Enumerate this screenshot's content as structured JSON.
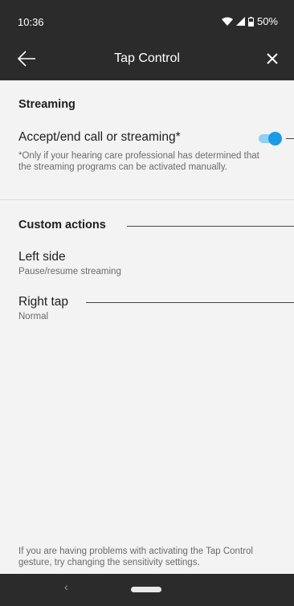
{
  "status_bar": {
    "time": "10:36",
    "battery": "50%",
    "icons": [
      "wifi-icon",
      "signal-icon",
      "battery-icon"
    ]
  },
  "app_bar": {
    "title": "Tap Control",
    "back_icon": "arrow-left-icon",
    "close_icon": "close-icon"
  },
  "streaming": {
    "heading": "Streaming",
    "toggle_label": "Accept/end call or streaming*",
    "toggle_on": true,
    "note": "*Only if your hearing care professional has determined that the streaming programs can be activated manually."
  },
  "custom_actions": {
    "heading": "Custom actions",
    "items": [
      {
        "title": "Left side",
        "value": "Pause/resume streaming"
      },
      {
        "title": "Right tap",
        "value": "Normal"
      }
    ]
  },
  "footer": {
    "note": "If you are having problems with activating the Tap Control gesture, try changing the sensitivity settings."
  },
  "nav": {
    "back_glyph": "‹"
  },
  "colors": {
    "bar": "#2b2b2b",
    "accent": "#1a9be6",
    "background": "#f3f3f3"
  }
}
